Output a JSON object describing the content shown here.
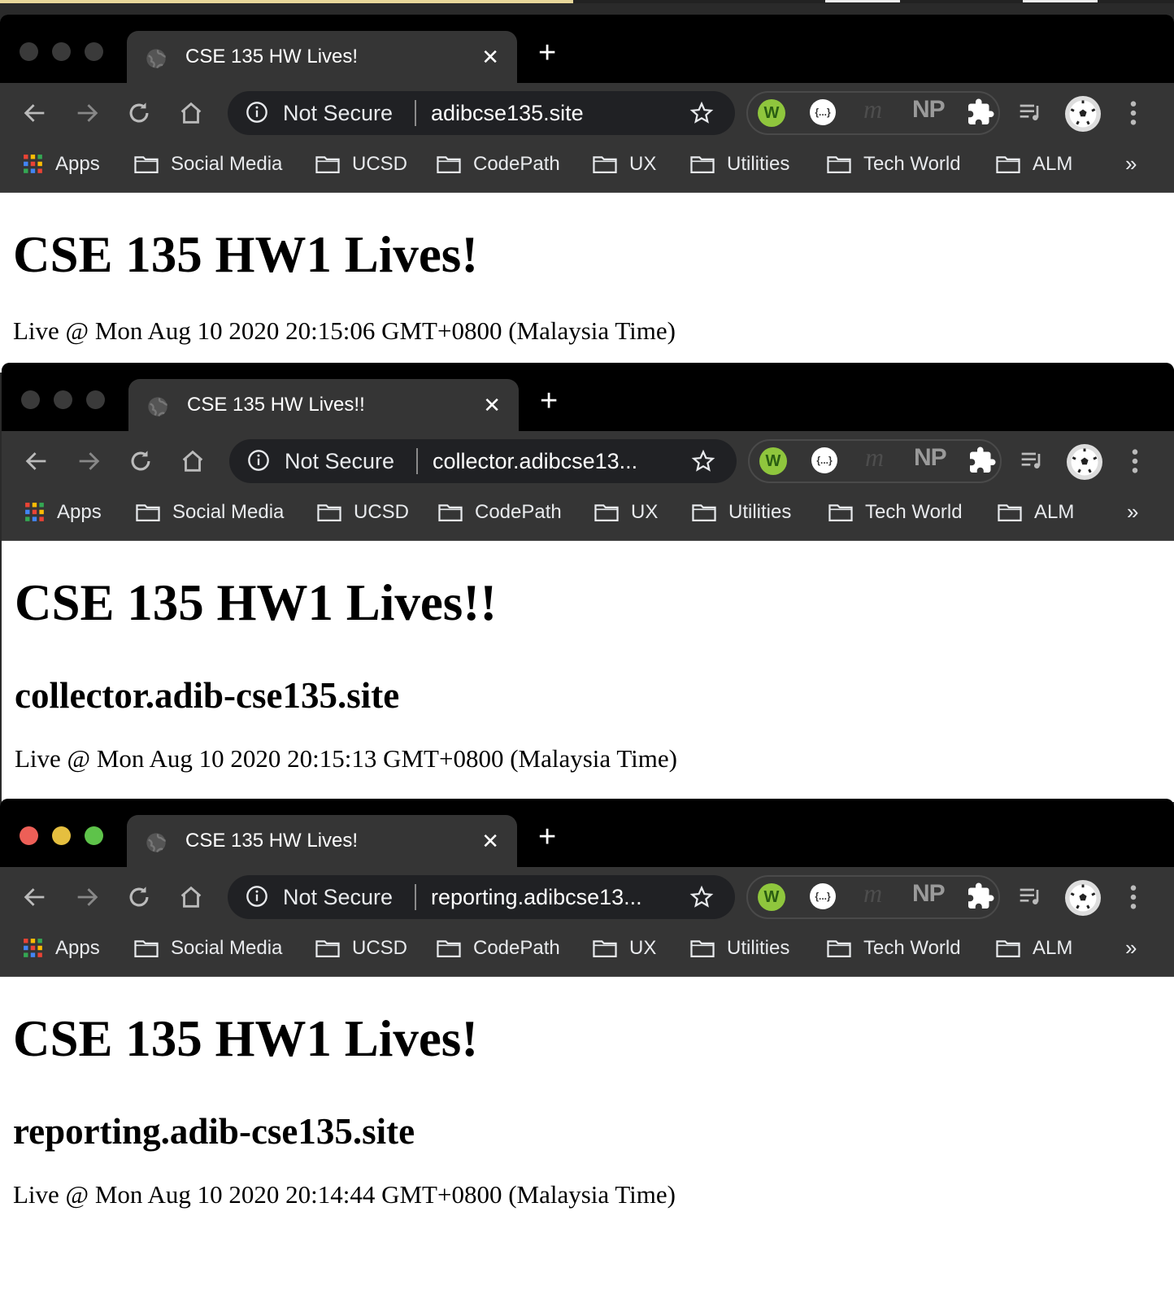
{
  "bookmarks": [
    "Apps",
    "Social Media",
    "UCSD",
    "CodePath",
    "UX",
    "Utilities",
    "Tech World",
    "ALM"
  ],
  "security_label": "Not Secure",
  "windows": [
    {
      "tab_title": "CSE 135 HW Lives!",
      "url": "adibcse135.site",
      "heading": "CSE 135 HW1 Lives!",
      "subheading": "",
      "live_text": "Live @ Mon Aug 10 2020 20:15:06 GMT+0800 (Malaysia Time)"
    },
    {
      "tab_title": "CSE 135 HW Lives!!",
      "url": "collector.adibcse13...",
      "heading": "CSE 135 HW1 Lives!!",
      "subheading": "collector.adib-cse135.site",
      "live_text": "Live @ Mon Aug 10 2020 20:15:13 GMT+0800 (Malaysia Time)"
    },
    {
      "tab_title": "CSE 135 HW Lives!",
      "url": "reporting.adibcse13...",
      "heading": "CSE 135 HW1 Lives!",
      "subheading": "reporting.adib-cse135.site",
      "live_text": "Live @ Mon Aug 10 2020 20:14:44 GMT+0800 (Malaysia Time)",
      "active": true
    }
  ],
  "extensions": [
    "W",
    "{...}",
    "m",
    "NP"
  ],
  "more_bookmarks_label": "»"
}
